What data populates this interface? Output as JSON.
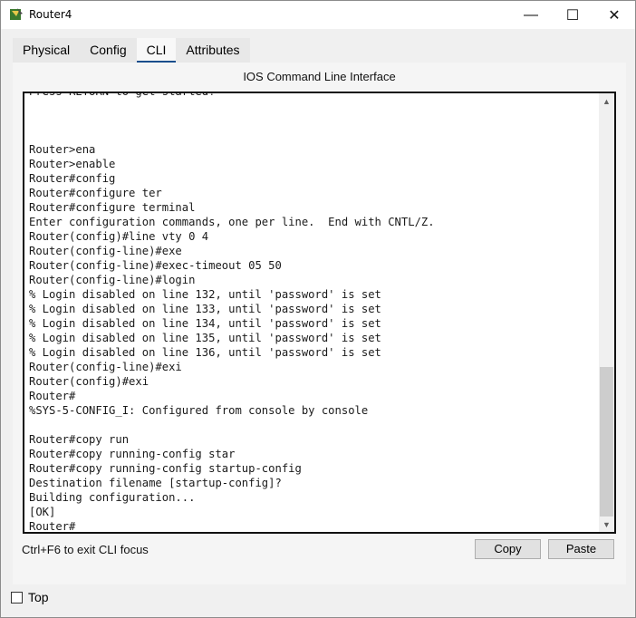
{
  "window": {
    "title": "Router4"
  },
  "titlebar_controls": {
    "minimize": "—",
    "maximize": "☐",
    "close": "✕"
  },
  "tabs": [
    {
      "label": "Physical",
      "active": false
    },
    {
      "label": "Config",
      "active": false
    },
    {
      "label": "CLI",
      "active": true
    },
    {
      "label": "Attributes",
      "active": false
    }
  ],
  "panel": {
    "title": "IOS Command Line Interface"
  },
  "terminal": {
    "lines": [
      "Press RETURN to get started!",
      "",
      "",
      "",
      "Router>ena",
      "Router>enable",
      "Router#config",
      "Router#configure ter",
      "Router#configure terminal",
      "Enter configuration commands, one per line.  End with CNTL/Z.",
      "Router(config)#line vty 0 4",
      "Router(config-line)#exe",
      "Router(config-line)#exec-timeout 05 50",
      "Router(config-line)#login",
      "% Login disabled on line 132, until 'password' is set",
      "% Login disabled on line 133, until 'password' is set",
      "% Login disabled on line 134, until 'password' is set",
      "% Login disabled on line 135, until 'password' is set",
      "% Login disabled on line 136, until 'password' is set",
      "Router(config-line)#exi",
      "Router(config)#exi",
      "Router#",
      "%SYS-5-CONFIG_I: Configured from console by console",
      "",
      "Router#copy run",
      "Router#copy running-config star",
      "Router#copy running-config startup-config",
      "Destination filename [startup-config]?",
      "Building configuration...",
      "[OK]",
      "Router#"
    ]
  },
  "scroll": {
    "up_icon": "▲",
    "down_icon": "▼"
  },
  "footer": {
    "hint": "Ctrl+F6 to exit CLI focus",
    "copy_label": "Copy",
    "paste_label": "Paste"
  },
  "bottom": {
    "top_label": "Top",
    "top_checked": false
  },
  "colors": {
    "tab_underline": "#1a4e8c",
    "window_bg": "#f0f0f0",
    "terminal_bg": "#ffffff"
  }
}
